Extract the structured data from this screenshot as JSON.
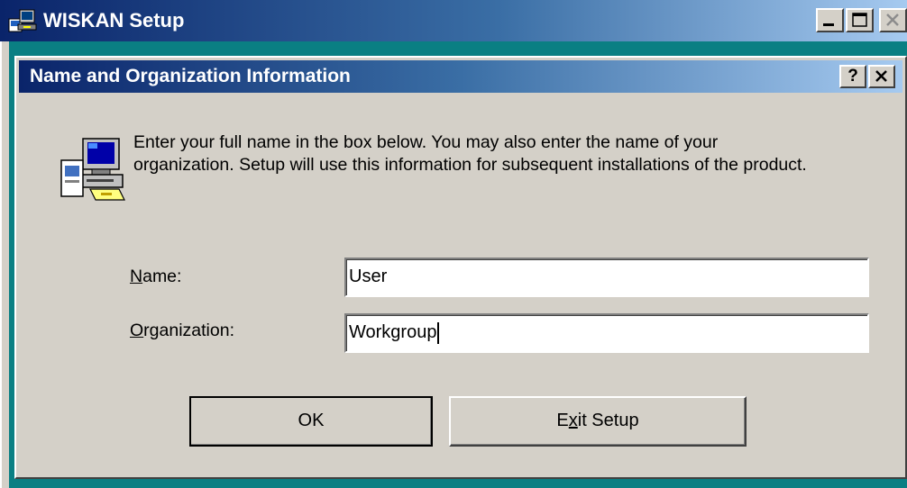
{
  "window": {
    "title": "WISKAN Setup",
    "icon": "setup-computer-icon"
  },
  "dialog": {
    "title": "Name and Organization Information",
    "help_glyph": "?",
    "intro_line1": "Enter your full name in the box below. You may also enter the name of your",
    "intro_line2": "organization. Setup will use this information for subsequent installations of the product."
  },
  "form": {
    "name_label_mnemonic": "N",
    "name_label_rest": "ame:",
    "name_value": "User",
    "org_label_mnemonic": "O",
    "org_label_rest": "rganization:",
    "org_value": "Workgroup"
  },
  "buttons": {
    "ok_label": "OK",
    "exit_label_pre": "E",
    "exit_label_mnemonic": "x",
    "exit_label_post": "it Setup"
  },
  "colors": {
    "titlebar_start": "#0a246a",
    "titlebar_end": "#a6caf0",
    "dialog_face": "#d4d0c8",
    "desktop": "#0a7f83"
  }
}
